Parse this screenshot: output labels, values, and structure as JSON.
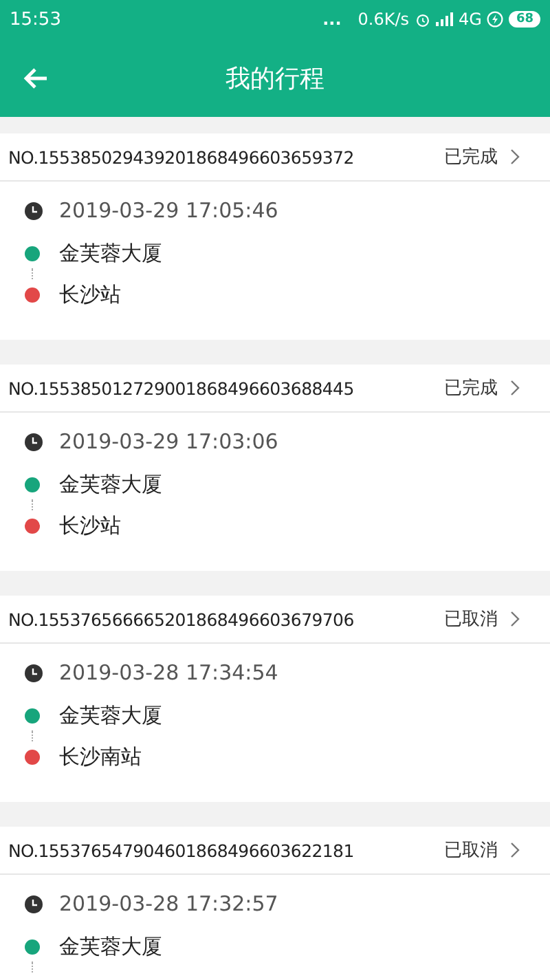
{
  "status_bar": {
    "time": "15:53",
    "dots": "...",
    "speed": "0.6K/s",
    "network": "4G",
    "battery": "68"
  },
  "toolbar": {
    "title": "我的行程"
  },
  "trips": [
    {
      "number": "NO.155385029439201868496603659372",
      "status": "已完成",
      "time": "2019-03-29 17:05:46",
      "origin": "金芙蓉大厦",
      "destination": "长沙站"
    },
    {
      "number": "NO.155385012729001868496603688445",
      "status": "已完成",
      "time": "2019-03-29 17:03:06",
      "origin": "金芙蓉大厦",
      "destination": "长沙站"
    },
    {
      "number": "NO.155376566665201868496603679706",
      "status": "已取消",
      "time": "2019-03-28 17:34:54",
      "origin": "金芙蓉大厦",
      "destination": "长沙南站"
    },
    {
      "number": "NO.155376547904601868496603622181",
      "status": "已取消",
      "time": "2019-03-28 17:32:57",
      "origin": "金芙蓉大厦"
    }
  ]
}
